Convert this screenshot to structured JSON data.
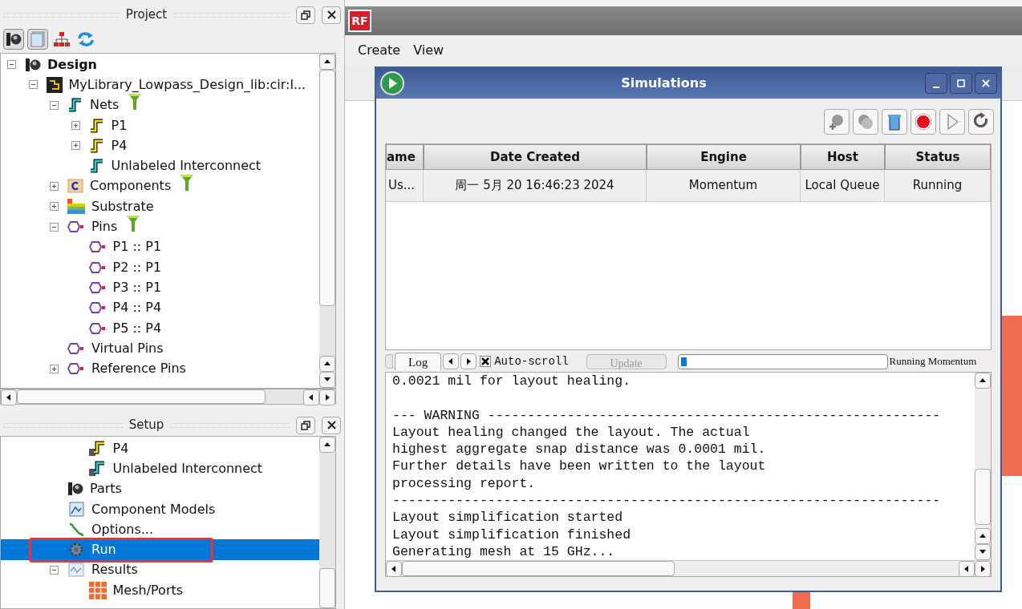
{
  "project_panel": {
    "title": "Project",
    "tree": [
      {
        "label": "Design",
        "kind": "root",
        "expanded": true,
        "children": [
          {
            "label": "MyLibrary_Lowpass_Design_lib:cir:l...",
            "kind": "library",
            "expanded": true,
            "children": [
              {
                "label": "Nets",
                "kind": "net",
                "color": "#22d3d8",
                "filter": true,
                "expanded": true,
                "children": [
                  {
                    "label": "P1",
                    "kind": "net",
                    "color": "#f5e600",
                    "expanded": false
                  },
                  {
                    "label": "P4",
                    "kind": "net",
                    "color": "#f5e600",
                    "expanded": false
                  },
                  {
                    "label": "Unlabeled Interconnect",
                    "kind": "net",
                    "color": "#22d3d8"
                  }
                ]
              },
              {
                "label": "Components",
                "kind": "component",
                "filter": true,
                "expanded": false
              },
              {
                "label": "Substrate",
                "kind": "substrate",
                "expanded": false
              },
              {
                "label": "Pins",
                "kind": "pin",
                "filter": true,
                "expanded": true,
                "children": [
                  {
                    "label": "P1 :: P1",
                    "kind": "pin"
                  },
                  {
                    "label": "P2 :: P1",
                    "kind": "pin"
                  },
                  {
                    "label": "P3 :: P1",
                    "kind": "pin"
                  },
                  {
                    "label": "P4 :: P4",
                    "kind": "pin"
                  },
                  {
                    "label": "P5 :: P4",
                    "kind": "pin"
                  }
                ]
              },
              {
                "label": "Virtual Pins",
                "kind": "pin"
              },
              {
                "label": "Reference Pins",
                "kind": "pin",
                "expanded": false
              }
            ]
          }
        ]
      }
    ]
  },
  "setup_panel": {
    "title": "Setup",
    "partial_items": [
      {
        "label": "P4",
        "kind": "net-port",
        "color": "#f5e600",
        "selected": false
      },
      {
        "label": "Unlabeled Interconnect",
        "kind": "net-port",
        "color": "#22d3d8",
        "selected": false
      }
    ],
    "tree": [
      {
        "label": "Parts",
        "kind": "design",
        "selected": false
      },
      {
        "label": "Component Models",
        "kind": "models",
        "selected": false
      },
      {
        "label": "Options...",
        "kind": "options",
        "selected": false
      },
      {
        "label": "Run",
        "kind": "run",
        "selected": true
      },
      {
        "label": "Results",
        "kind": "results",
        "selected": false,
        "expanded": true,
        "children": [
          {
            "label": "Mesh/Ports",
            "kind": "mesh",
            "selected": false
          }
        ]
      }
    ]
  },
  "app": {
    "logo": "RF",
    "menu": [
      "Create",
      "View"
    ]
  },
  "simulations": {
    "title": "Simulations",
    "columns": [
      "ame",
      "Date Created",
      "Engine",
      "Host",
      "Status"
    ],
    "rows": [
      [
        "Us...",
        "周一 5月 20 16:46:23 2024",
        "Momentum",
        "Local Queue",
        "Running"
      ]
    ],
    "log_tabs": [
      {
        "label": "Log",
        "selected": true
      }
    ],
    "auto_scroll": {
      "label": "Auto-scroll",
      "checked": true
    },
    "update_button": {
      "label": "Update",
      "disabled": true
    },
    "progress": {
      "level": 0.03
    },
    "status": "Running Momentum",
    "log_blocks": [
      [
        "0.0021 mil for layout healing."
      ],
      [
        "--- WARNING ---------------------------------------------------------",
        "Layout healing changed the layout. The actual",
        "highest aggregate snap distance was 0.0001 mil.",
        "Further details have been written to the layout",
        "processing report.",
        "---------------------------------------------------------------------",
        "Layout simplification started",
        "Layout simplification finished",
        "Generating mesh at 15 GHz..."
      ]
    ]
  }
}
